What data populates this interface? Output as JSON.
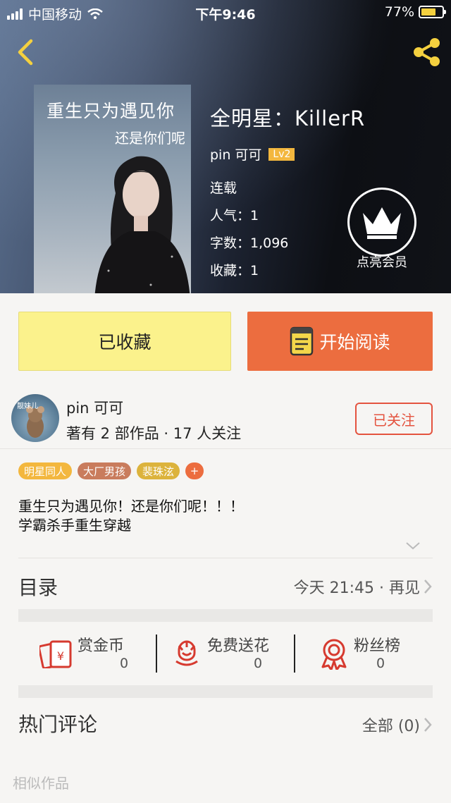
{
  "status_bar": {
    "carrier": "中国移动",
    "time": "下午9:46",
    "battery": "77%"
  },
  "book": {
    "cover_line1": "重生只为遇见你",
    "cover_line2": "还是你们呢",
    "title": "全明星：KillerR",
    "author": "pin 可可",
    "level": "Lv2",
    "status": "连载",
    "popularity": "人气：1",
    "word_count": "字数：1,096",
    "favorites": "收藏：1"
  },
  "vip": {
    "label": "点亮会员"
  },
  "actions": {
    "favorited": "已收藏",
    "start_reading": "开始阅读"
  },
  "author_card": {
    "avatar_tag": "靓妹儿",
    "name": "pin 可可",
    "stats": "著有 2 部作品 · 17 人关注",
    "follow_label": "已关注"
  },
  "tags": [
    "明星同人",
    "大厂男孩",
    "裴珠泫",
    "+"
  ],
  "description": [
    "重生只为遇见你！还是你们呢！！！",
    "学霸杀手重生穿越"
  ],
  "toc": {
    "title": "目录",
    "latest": "今天 21:45 · 再见"
  },
  "stats": [
    {
      "label": "赏金币",
      "value": "0",
      "icon": "red-envelope-icon"
    },
    {
      "label": "免费送花",
      "value": "0",
      "icon": "flower-icon"
    },
    {
      "label": "粉丝榜",
      "value": "0",
      "icon": "ribbon-medal-icon"
    }
  ],
  "hot_comments": {
    "title": "热门评论",
    "all_label": "全部 (0)"
  },
  "similar": {
    "title": "相似作品"
  },
  "colors": {
    "accent_orange": "#ec6d3f",
    "fav_yellow": "#fbf28c",
    "follow_red": "#e4533f",
    "level_badge": "#f3b73e"
  }
}
